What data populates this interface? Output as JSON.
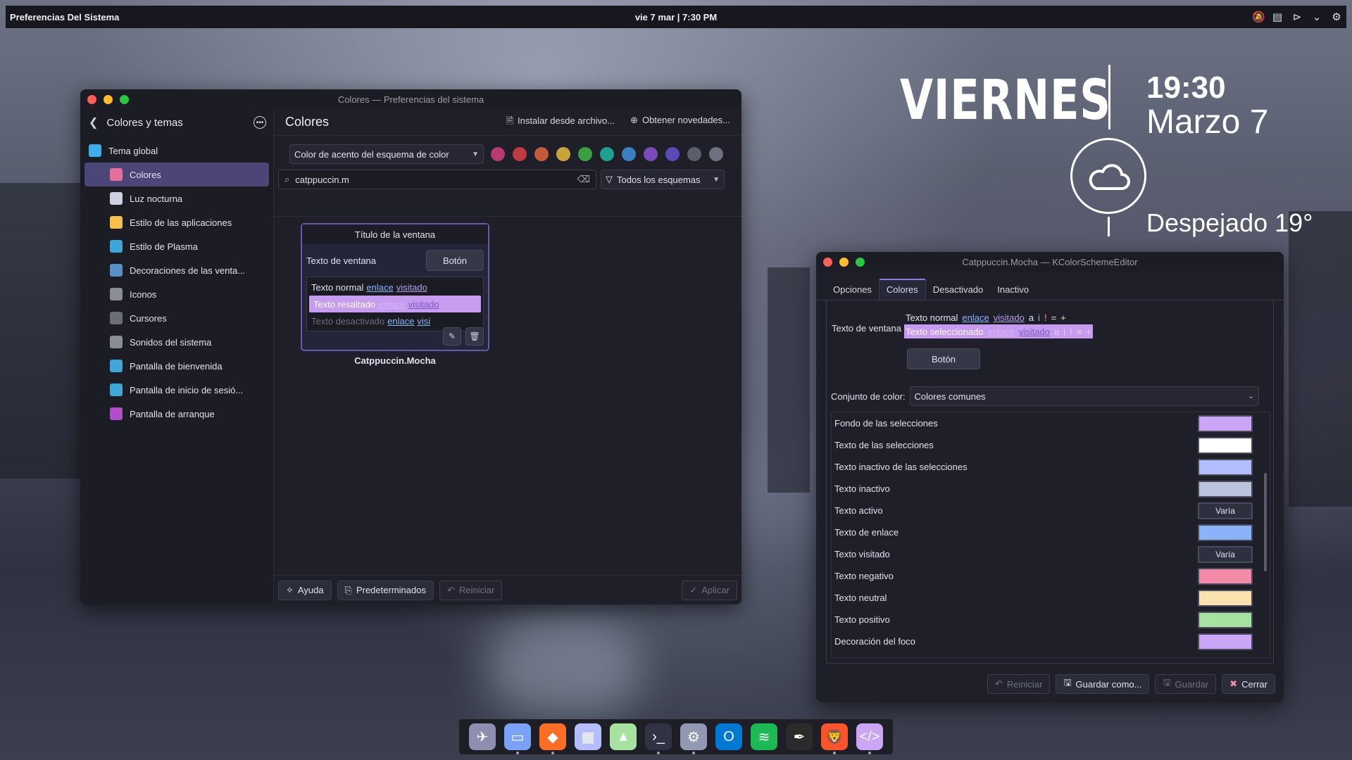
{
  "topbar": {
    "app_title": "Preferencias Del Sistema",
    "clock": "vie 7 mar | 7:30 PM",
    "tray_icons": [
      "bell-slash-icon",
      "clipboard-icon",
      "media-play-icon",
      "chevron-down-icon",
      "settings-icon"
    ]
  },
  "widget": {
    "day": "VIERNES",
    "time": "19:30",
    "date": "Marzo 7",
    "weather": "Despejado 19°",
    "weather_icon": "cloud-icon"
  },
  "main_window": {
    "title": "Colores — Preferencias del sistema",
    "sidebar": {
      "header": "Colores y temas",
      "items": [
        {
          "label": "Tema global",
          "icon": "global-theme-icon",
          "color": "#3daee9"
        },
        {
          "label": "Colores",
          "icon": "colors-icon",
          "color": "#e66f9a"
        },
        {
          "label": "Luz nocturna",
          "icon": "night-light-icon",
          "color": "#cfd1de"
        },
        {
          "label": "Estilo de las aplicaciones",
          "icon": "app-style-icon",
          "color": "#f3c14a"
        },
        {
          "label": "Estilo de Plasma",
          "icon": "plasma-style-icon",
          "color": "#3fa6d8"
        },
        {
          "label": "Decoraciones de las venta...",
          "icon": "window-decorations-icon",
          "color": "#5a8fc8"
        },
        {
          "label": "Iconos",
          "icon": "icons-icon",
          "color": "#8a8c98"
        },
        {
          "label": "Cursores",
          "icon": "cursors-icon",
          "color": "#6a6c78"
        },
        {
          "label": "Sonidos del sistema",
          "icon": "sound-icon",
          "color": "#8a8c98"
        },
        {
          "label": "Pantalla de bienvenida",
          "icon": "splash-icon",
          "color": "#3fa6d8"
        },
        {
          "label": "Pantalla de inicio de sesió...",
          "icon": "login-screen-icon",
          "color": "#3fa6d8"
        },
        {
          "label": "Pantalla de arranque",
          "icon": "boot-screen-icon",
          "color": "#b04fc7"
        }
      ]
    },
    "content": {
      "title": "Colores",
      "install_label": "Instalar desde archivo...",
      "get_new_label": "Obtener novedades...",
      "accent_dropdown": "Color de acento del esquema de color",
      "accent_swatches": [
        "#b83a73",
        "#c03a45",
        "#c55a3a",
        "#c8a53a",
        "#3aa043",
        "#1fa091",
        "#3a7fc0",
        "#7a4ab8",
        "#5a4ab8",
        "#5c5e6b",
        "#6e7080"
      ],
      "search_value": "catppuccin.m",
      "filter_label": "Todos los esquemas",
      "preview": {
        "window_title": "Título de la ventana",
        "window_text": "Texto de ventana",
        "button": "Botón",
        "normal_text": "Texto normal",
        "highlight_text": "Texto resaltado",
        "disabled_text": "Texto desactivado",
        "link": "enlace",
        "visited": "visitado",
        "visited_cut": "visi",
        "scheme_name": "Catppuccin.Mocha"
      },
      "footer": {
        "help": "Ayuda",
        "defaults": "Predeterminados",
        "reset": "Reiniciar",
        "apply": "Aplicar"
      }
    }
  },
  "editor_window": {
    "title": "Catppuccin.Mocha — KColorSchemeEditor",
    "tabs": [
      "Opciones",
      "Colores",
      "Desactivado",
      "Inactivo"
    ],
    "window_text": "Texto de ventana",
    "normal_text": "Texto normal",
    "selected_text": "Texto seleccionado",
    "link": "enlace",
    "visited": "visitado",
    "glyphs": [
      "a",
      "i",
      "!",
      "=",
      "+"
    ],
    "button": "Botón",
    "color_set_label": "Conjunto de color:",
    "color_set_value": "Colores comunes",
    "roles": [
      {
        "label": "Fondo de las selecciones",
        "color": "#cba6f7",
        "text": ""
      },
      {
        "label": "Texto de las selecciones",
        "color": "#ffffff",
        "text": ""
      },
      {
        "label": "Texto inactivo de las selecciones",
        "color": "#b4befe",
        "text": ""
      },
      {
        "label": "Texto inactivo",
        "color": "#bac2de",
        "text": ""
      },
      {
        "label": "Texto activo",
        "color": "",
        "text": "Varía"
      },
      {
        "label": "Texto de enlace",
        "color": "#89b4fa",
        "text": ""
      },
      {
        "label": "Texto visitado",
        "color": "",
        "text": "Varía"
      },
      {
        "label": "Texto negativo",
        "color": "#f38ba8",
        "text": ""
      },
      {
        "label": "Texto neutral",
        "color": "#f9e2af",
        "text": ""
      },
      {
        "label": "Texto positivo",
        "color": "#a6e3a1",
        "text": ""
      },
      {
        "label": "Decoración del foco",
        "color": "#cba6f7",
        "text": ""
      }
    ],
    "footer": {
      "reset": "Reiniciar",
      "save_as": "Guardar como...",
      "save": "Guardar",
      "close": "Cerrar"
    }
  },
  "dock": {
    "apps": [
      "telegram-icon",
      "file-manager-icon",
      "gitlab-icon",
      "store-icon",
      "image-viewer-icon",
      "terminal-icon",
      "system-settings-icon",
      "outlook-icon",
      "spotify-icon",
      "inkscape-icon",
      "brave-icon",
      "code-editor-icon"
    ]
  }
}
